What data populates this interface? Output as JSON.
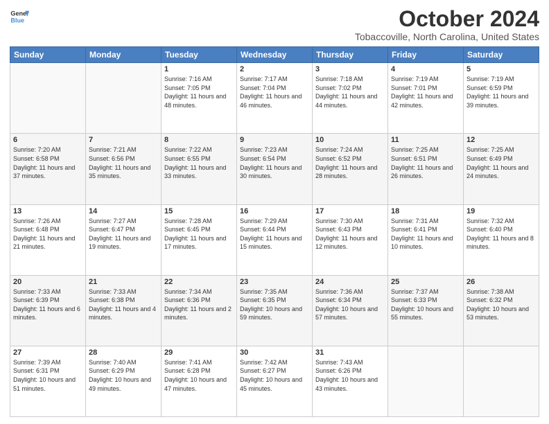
{
  "header": {
    "logo_line1": "General",
    "logo_line2": "Blue",
    "title": "October 2024",
    "subtitle": "Tobaccoville, North Carolina, United States"
  },
  "calendar": {
    "days_of_week": [
      "Sunday",
      "Monday",
      "Tuesday",
      "Wednesday",
      "Thursday",
      "Friday",
      "Saturday"
    ],
    "weeks": [
      [
        {
          "day": "",
          "info": ""
        },
        {
          "day": "",
          "info": ""
        },
        {
          "day": "1",
          "info": "Sunrise: 7:16 AM\nSunset: 7:05 PM\nDaylight: 11 hours and 48 minutes."
        },
        {
          "day": "2",
          "info": "Sunrise: 7:17 AM\nSunset: 7:04 PM\nDaylight: 11 hours and 46 minutes."
        },
        {
          "day": "3",
          "info": "Sunrise: 7:18 AM\nSunset: 7:02 PM\nDaylight: 11 hours and 44 minutes."
        },
        {
          "day": "4",
          "info": "Sunrise: 7:19 AM\nSunset: 7:01 PM\nDaylight: 11 hours and 42 minutes."
        },
        {
          "day": "5",
          "info": "Sunrise: 7:19 AM\nSunset: 6:59 PM\nDaylight: 11 hours and 39 minutes."
        }
      ],
      [
        {
          "day": "6",
          "info": "Sunrise: 7:20 AM\nSunset: 6:58 PM\nDaylight: 11 hours and 37 minutes."
        },
        {
          "day": "7",
          "info": "Sunrise: 7:21 AM\nSunset: 6:56 PM\nDaylight: 11 hours and 35 minutes."
        },
        {
          "day": "8",
          "info": "Sunrise: 7:22 AM\nSunset: 6:55 PM\nDaylight: 11 hours and 33 minutes."
        },
        {
          "day": "9",
          "info": "Sunrise: 7:23 AM\nSunset: 6:54 PM\nDaylight: 11 hours and 30 minutes."
        },
        {
          "day": "10",
          "info": "Sunrise: 7:24 AM\nSunset: 6:52 PM\nDaylight: 11 hours and 28 minutes."
        },
        {
          "day": "11",
          "info": "Sunrise: 7:25 AM\nSunset: 6:51 PM\nDaylight: 11 hours and 26 minutes."
        },
        {
          "day": "12",
          "info": "Sunrise: 7:25 AM\nSunset: 6:49 PM\nDaylight: 11 hours and 24 minutes."
        }
      ],
      [
        {
          "day": "13",
          "info": "Sunrise: 7:26 AM\nSunset: 6:48 PM\nDaylight: 11 hours and 21 minutes."
        },
        {
          "day": "14",
          "info": "Sunrise: 7:27 AM\nSunset: 6:47 PM\nDaylight: 11 hours and 19 minutes."
        },
        {
          "day": "15",
          "info": "Sunrise: 7:28 AM\nSunset: 6:45 PM\nDaylight: 11 hours and 17 minutes."
        },
        {
          "day": "16",
          "info": "Sunrise: 7:29 AM\nSunset: 6:44 PM\nDaylight: 11 hours and 15 minutes."
        },
        {
          "day": "17",
          "info": "Sunrise: 7:30 AM\nSunset: 6:43 PM\nDaylight: 11 hours and 12 minutes."
        },
        {
          "day": "18",
          "info": "Sunrise: 7:31 AM\nSunset: 6:41 PM\nDaylight: 11 hours and 10 minutes."
        },
        {
          "day": "19",
          "info": "Sunrise: 7:32 AM\nSunset: 6:40 PM\nDaylight: 11 hours and 8 minutes."
        }
      ],
      [
        {
          "day": "20",
          "info": "Sunrise: 7:33 AM\nSunset: 6:39 PM\nDaylight: 11 hours and 6 minutes."
        },
        {
          "day": "21",
          "info": "Sunrise: 7:33 AM\nSunset: 6:38 PM\nDaylight: 11 hours and 4 minutes."
        },
        {
          "day": "22",
          "info": "Sunrise: 7:34 AM\nSunset: 6:36 PM\nDaylight: 11 hours and 2 minutes."
        },
        {
          "day": "23",
          "info": "Sunrise: 7:35 AM\nSunset: 6:35 PM\nDaylight: 10 hours and 59 minutes."
        },
        {
          "day": "24",
          "info": "Sunrise: 7:36 AM\nSunset: 6:34 PM\nDaylight: 10 hours and 57 minutes."
        },
        {
          "day": "25",
          "info": "Sunrise: 7:37 AM\nSunset: 6:33 PM\nDaylight: 10 hours and 55 minutes."
        },
        {
          "day": "26",
          "info": "Sunrise: 7:38 AM\nSunset: 6:32 PM\nDaylight: 10 hours and 53 minutes."
        }
      ],
      [
        {
          "day": "27",
          "info": "Sunrise: 7:39 AM\nSunset: 6:31 PM\nDaylight: 10 hours and 51 minutes."
        },
        {
          "day": "28",
          "info": "Sunrise: 7:40 AM\nSunset: 6:29 PM\nDaylight: 10 hours and 49 minutes."
        },
        {
          "day": "29",
          "info": "Sunrise: 7:41 AM\nSunset: 6:28 PM\nDaylight: 10 hours and 47 minutes."
        },
        {
          "day": "30",
          "info": "Sunrise: 7:42 AM\nSunset: 6:27 PM\nDaylight: 10 hours and 45 minutes."
        },
        {
          "day": "31",
          "info": "Sunrise: 7:43 AM\nSunset: 6:26 PM\nDaylight: 10 hours and 43 minutes."
        },
        {
          "day": "",
          "info": ""
        },
        {
          "day": "",
          "info": ""
        }
      ]
    ]
  }
}
